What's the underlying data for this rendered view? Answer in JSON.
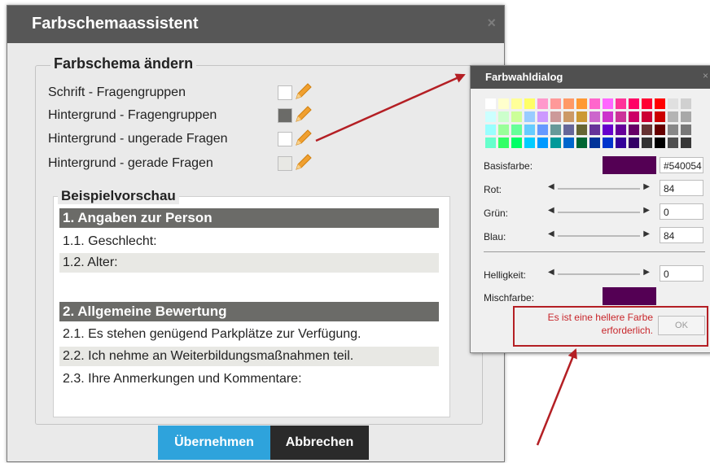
{
  "dialog": {
    "title": "Farbschemaassistent",
    "close_symbol": "×",
    "section_title": "Farbschema ändern",
    "options": [
      {
        "label": "Schrift - Fragengruppen",
        "swatch": "#ffffff"
      },
      {
        "label": "Hintergrund - Fragengruppen",
        "swatch": "#6b6b68"
      },
      {
        "label": "Hintergrund - ungerade Fragen",
        "swatch": "#ffffff"
      },
      {
        "label": "Hintergrund - gerade Fragen",
        "swatch": "#e8e8e4"
      }
    ],
    "preview_title": "Beispielvorschau",
    "preview_rows": [
      {
        "text": "1. Angaben zur Person",
        "kind": "group"
      },
      {
        "text": "1.1. Geschlecht:",
        "kind": "odd"
      },
      {
        "text": "1.2. Alter:",
        "kind": "even"
      },
      {
        "text": "2. Allgemeine Bewertung",
        "kind": "group"
      },
      {
        "text": "2.1. Es stehen genügend Parkplätze zur Verfügung.",
        "kind": "odd"
      },
      {
        "text": "2.2. Ich nehme an Weiterbildungsmaßnahmen teil.",
        "kind": "even"
      },
      {
        "text": "2.3. Ihre Anmerkungen und Kommentare:",
        "kind": "odd"
      }
    ],
    "buttons": {
      "apply": "Übernehmen",
      "cancel": "Abbrechen"
    },
    "colors": {
      "titlebar": "#575757",
      "apply_btn": "#2ea3dc",
      "cancel_btn": "#2a2a2a",
      "group_bg": "#6b6b68"
    }
  },
  "picker": {
    "title": "Farbwahldialog",
    "close_symbol": "×",
    "base_label": "Basisfarbe:",
    "base_hex": "#540054",
    "red_label": "Rot:",
    "red_value": "84",
    "red_level": 0.33,
    "green_label": "Grün:",
    "green_value": "0",
    "green_level": 0,
    "blue_label": "Blau:",
    "blue_value": "84",
    "blue_level": 0.33,
    "brightness_label": "Helligkeit:",
    "brightness_value": "0",
    "brightness_level": 0,
    "mix_label": "Mischfarbe:",
    "warning": "Es ist eine hellere Farbe erforderlich.",
    "ok_label": "OK",
    "palette": [
      [
        "#ffffff",
        "#ffffcc",
        "#ffff99",
        "#ffff66",
        "#ff99cc",
        "#ff9999",
        "#ff9966",
        "#ff9933",
        "#ff66cc",
        "#ff66ff",
        "#ff3399",
        "#ff0066",
        "#ff0033",
        "#ff0000",
        "#e0e0e0",
        "#d0d0d0"
      ],
      [
        "#ccffff",
        "#ccffcc",
        "#ccff99",
        "#99ccff",
        "#cc99ff",
        "#cc9999",
        "#cc9966",
        "#cc9933",
        "#cc66cc",
        "#cc33cc",
        "#cc3399",
        "#cc0066",
        "#cc0033",
        "#cc0000",
        "#b4b4b4",
        "#a8a8a8"
      ],
      [
        "#99ffff",
        "#99ff99",
        "#66ff99",
        "#66ccff",
        "#6699ff",
        "#669999",
        "#666699",
        "#666633",
        "#663399",
        "#6600cc",
        "#660099",
        "#660066",
        "#663333",
        "#660000",
        "#888888",
        "#787878"
      ],
      [
        "#66ffcc",
        "#33ff66",
        "#00ff66",
        "#00ccff",
        "#0099ff",
        "#009999",
        "#0066cc",
        "#006633",
        "#003399",
        "#0033cc",
        "#330099",
        "#330066",
        "#333333",
        "#000000",
        "#505050",
        "#383838"
      ]
    ]
  }
}
